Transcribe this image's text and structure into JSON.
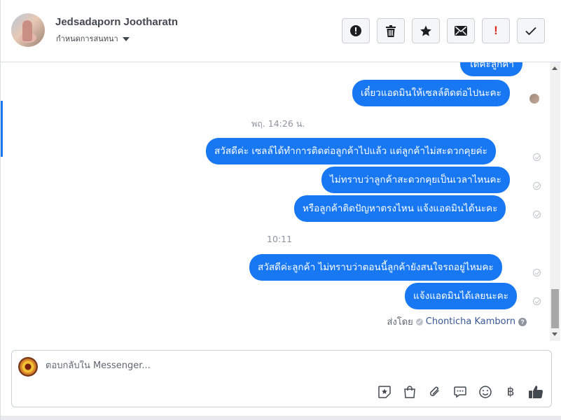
{
  "header": {
    "name": "Jedsadaporn Jootharatn",
    "subtitle": "กำหนดการสนทนา",
    "actions": [
      {
        "id": "report",
        "icon": "alert-circle-icon"
      },
      {
        "id": "delete",
        "icon": "trash-icon"
      },
      {
        "id": "star",
        "icon": "star-icon"
      },
      {
        "id": "mark-unread",
        "icon": "envelope-icon"
      },
      {
        "id": "spam",
        "label": "!",
        "icon": "exclamation-icon"
      },
      {
        "id": "done",
        "icon": "check-icon"
      }
    ]
  },
  "thread": {
    "messages": [
      {
        "text": "ได้ค่ะลูกค้า"
      },
      {
        "text": "เดี๋ยวแอดมินให้เซลล์ติดต่อไปนะคะ"
      },
      {
        "text": "สวัสดีค่ะ เซลล์ได้ทำการติดต่อลูกค้าไปแล้ว แต่ลูกค้าไม่สะดวกคุยค่ะ"
      },
      {
        "text": "ไม่ทราบว่าลูกค้าสะดวกคุยเป็นเวลาไหนคะ"
      },
      {
        "text": "หรือลูกค้าติดปัญหาตรงไหน แจ้งแอดมินได้นะคะ"
      },
      {
        "text": "สวัสดีค่ะลูกค้า ไม่ทราบว่าตอนนี้ลูกค้ายังสนใจรถอยู่ไหมคะ"
      },
      {
        "text": "แจ้งแอดมินได้เลยนะคะ"
      }
    ],
    "timestamps": [
      "พฤ. 14:26 น.",
      "10:11"
    ],
    "sent_by_label": "ส่งโดย",
    "sent_by_name": "Chonticha Kamborn",
    "help_glyph": "?"
  },
  "composer": {
    "placeholder": "ตอบกลับใน Messenger...",
    "baht": "฿",
    "icons": [
      "sticker-icon",
      "shopping-bag-icon",
      "paperclip-icon",
      "saved-reply-icon",
      "emoji-icon",
      "baht-icon",
      "like-icon"
    ]
  },
  "colors": {
    "bubble": "#1877f2",
    "accent": "#1877f2"
  }
}
